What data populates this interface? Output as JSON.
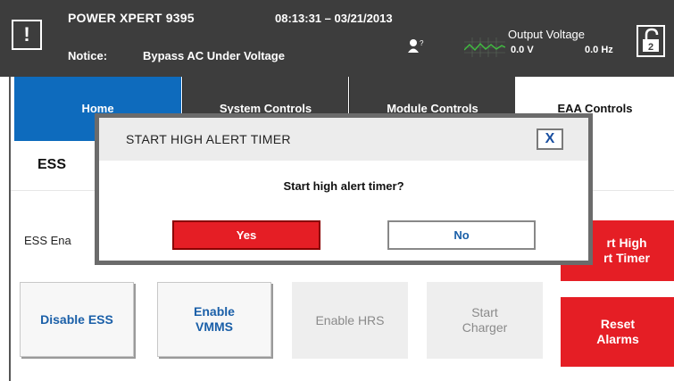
{
  "header": {
    "alert_symbol": "!",
    "device_name": "POWER XPERT 9395",
    "datetime": "08:13:31 – 03/21/2013",
    "notice_label": "Notice:",
    "notice_text": "Bypass AC Under Voltage",
    "user_icon": "user-help-icon",
    "wave_icon": "waveform-icon",
    "output_voltage_label": "Output Voltage",
    "output_voltage_value": "0.0 V",
    "output_frequency_value": "0.0 Hz",
    "lock_icon": "unlock-icon",
    "lock_number": "2"
  },
  "tabs": [
    {
      "label": "Home"
    },
    {
      "label": "System Controls"
    },
    {
      "label": "Module Controls"
    },
    {
      "label": "EAA Controls"
    }
  ],
  "main": {
    "section_label": "ESS",
    "ess_enable_label": "ESS Ena",
    "buttons": {
      "disable_ess": "Disable ESS",
      "enable_vmms_l1": "Enable",
      "enable_vmms_l2": "VMMS",
      "enable_hrs": "Enable HRS",
      "start_charger_l1": "Start",
      "start_charger_l2": "Charger",
      "reset_alarms_l1": "Reset",
      "reset_alarms_l2": "Alarms",
      "timer_l1": "rt High",
      "timer_l2": "rt Timer"
    }
  },
  "dialog": {
    "title": "START HIGH ALERT TIMER",
    "close_label": "X",
    "message": "Start high alert timer?",
    "yes_label": "Yes",
    "no_label": "No"
  },
  "colors": {
    "header_bg": "#3d3d3d",
    "home_tab": "#0e6bbd",
    "alert_red": "#e51e25",
    "link_blue": "#1a5fa8"
  }
}
